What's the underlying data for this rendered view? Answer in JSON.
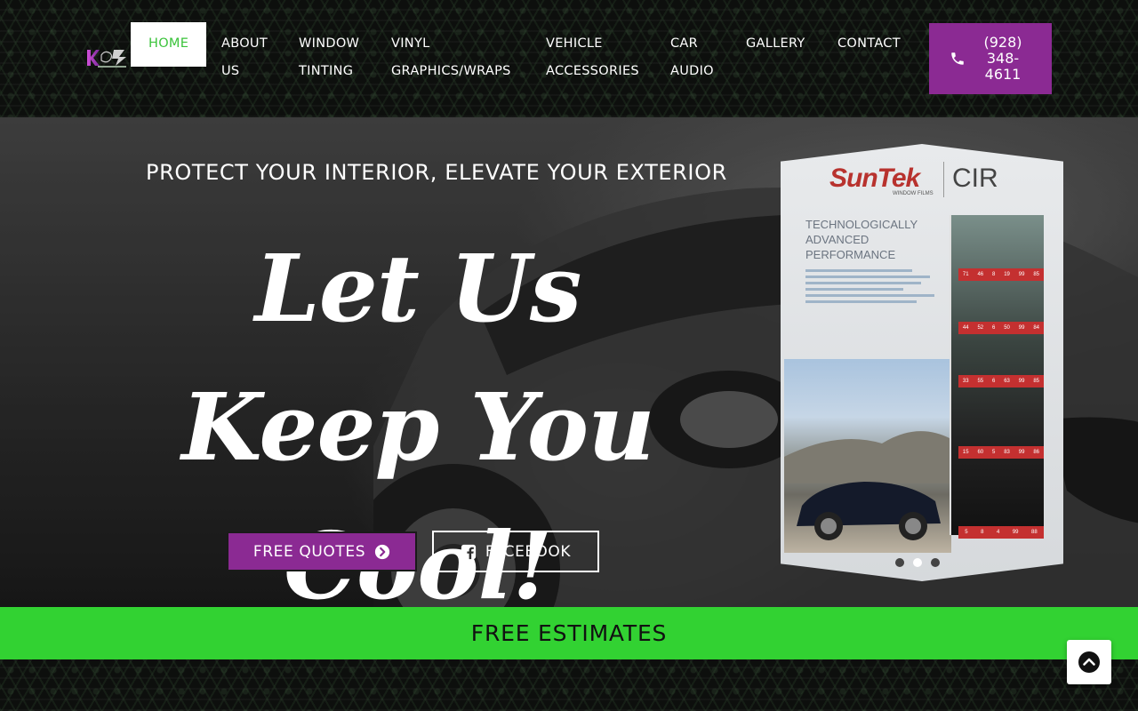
{
  "header": {
    "logo_text": "Kuz",
    "nav": [
      {
        "label": "HOME",
        "active": true
      },
      {
        "label": "ABOUT US"
      },
      {
        "label": "WINDOW TINTING"
      },
      {
        "label": "VINYL GRAPHICS/WRAPS"
      },
      {
        "label": "VEHICLE ACCESSORIES"
      },
      {
        "label": "CAR AUDIO"
      },
      {
        "label": "GALLERY"
      },
      {
        "label": "CONTACT"
      }
    ],
    "phone": "(928) 348-4611",
    "phone_icon": "phone-icon"
  },
  "hero": {
    "tagline": "PROTECT YOUR INTERIOR, ELEVATE YOUR EXTERIOR",
    "headline": "Let Us Keep You Cool!",
    "buttons": {
      "quotes": {
        "label": "FREE QUOTES",
        "icon": "chevron-circle-right-icon"
      },
      "facebook": {
        "label": "FACEBOOK",
        "icon": "facebook-square-icon"
      }
    },
    "display": {
      "brand": "SunTek",
      "brand_sub": "WINDOW FILMS",
      "product": "CIR",
      "heading": "TECHNOLOGICALLY ADVANCED PERFORMANCE"
    },
    "slider": {
      "count": 3,
      "active_index": 1
    }
  },
  "banner": {
    "label": "FREE ESTIMATES"
  },
  "colors": {
    "accent_purple": "#8b2a93",
    "accent_green": "#32d232",
    "nav_active_text": "#3bc33b"
  }
}
